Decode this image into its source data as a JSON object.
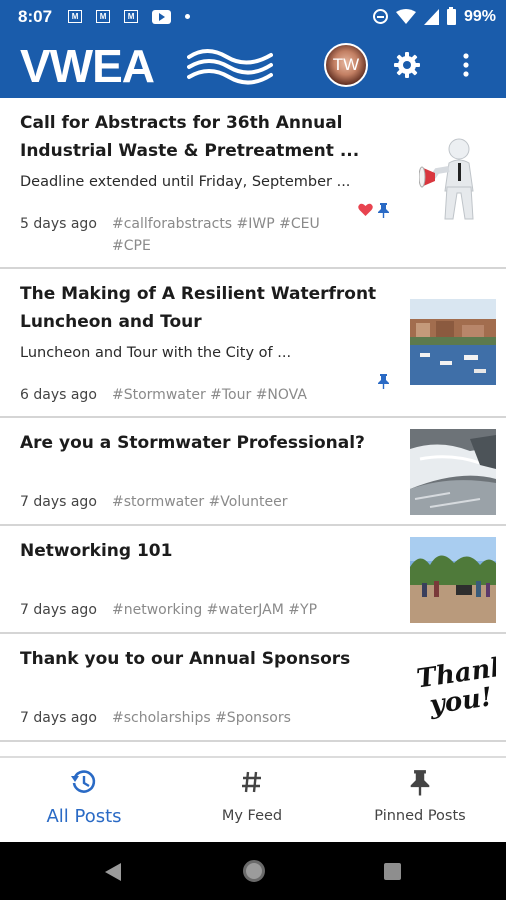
{
  "status_bar": {
    "time": "8:07",
    "notification_icons": [
      "M",
      "M",
      "M",
      "youtube-icon",
      "dot-icon"
    ],
    "battery": "99%"
  },
  "app_bar": {
    "logo": "VWEA",
    "avatar_initials": "TW",
    "brand_color": "#1a5cab"
  },
  "posts": [
    {
      "title_line1": "Call for Abstracts for 36th Annual",
      "title_line2": "Industrial Waste & Pretreatment ...",
      "subtitle": "Deadline extended until Friday, September ...",
      "date": "5 days ago",
      "tags_line1": "#callforabstracts #IWP #CEU",
      "tags_line2": "#CPE",
      "liked": true,
      "pinned": true,
      "thumbnail": "megaphone-figure"
    },
    {
      "title_line1": "The Making of A Resilient Waterfront",
      "title_line2": "Luncheon and Tour",
      "subtitle": "Luncheon and Tour with the City of ...",
      "date": "6 days ago",
      "tags_line1": "#Stormwater #Tour #NOVA",
      "pinned": true,
      "thumbnail": "waterfront-photo"
    },
    {
      "title_line1": "Are you a Stormwater Professional?",
      "date": "7 days ago",
      "tags_line1": "#stormwater #Volunteer",
      "thumbnail": "stormwater-photo"
    },
    {
      "title_line1": "Networking 101",
      "date": "7 days ago",
      "tags_line1": "#networking #waterJAM #YP",
      "thumbnail": "networking-photo"
    },
    {
      "title_line1": "Thank you to our Annual Sponsors",
      "date": "7 days ago",
      "tags_line1": "#scholarships #Sponsors",
      "thumbnail": "thank-you-script",
      "thumbnail_text_1": "Thank",
      "thumbnail_text_2": "you!"
    }
  ],
  "bottom_nav": {
    "items": [
      {
        "label": "All Posts",
        "icon": "history-icon",
        "active": true
      },
      {
        "label": "My Feed",
        "icon": "hashtag-icon",
        "active": false
      },
      {
        "label": "Pinned Posts",
        "icon": "pin-icon",
        "active": false
      }
    ],
    "active_color": "#2a6ac5"
  }
}
